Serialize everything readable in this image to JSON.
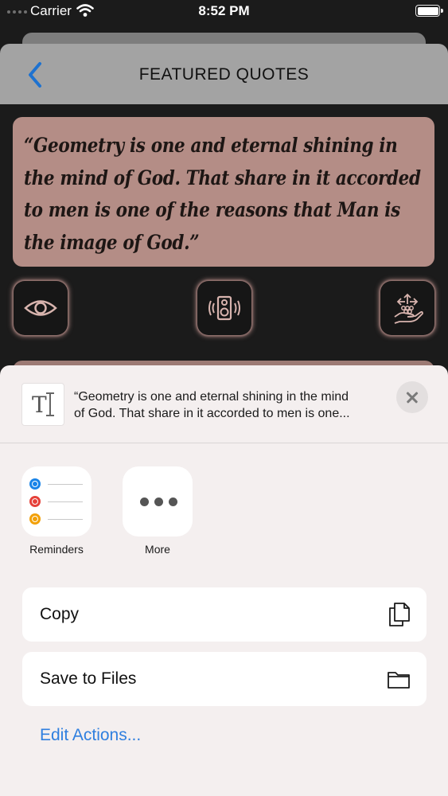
{
  "status_bar": {
    "carrier": "Carrier",
    "time": "8:52 PM"
  },
  "nav": {
    "title": "FEATURED QUOTES",
    "back_icon": "chevron-left-icon"
  },
  "quote": {
    "text": "“Geometry is one and eternal shining in the mind of God. That share in it accorded to men is one of the reasons that Man is the image of God.”"
  },
  "quote_actions": {
    "view_icon": "eye-icon",
    "speak_icon": "speaker-icon",
    "share_icon": "share-hand-icon"
  },
  "share_sheet": {
    "preview_line1": "“Geometry is one and eternal shining in the mind",
    "preview_line2": "of God. That share in it accorded to men is one...",
    "apps": [
      {
        "label": "Reminders",
        "icon": "reminders-icon"
      },
      {
        "label": "More",
        "icon": "more-icon"
      }
    ],
    "actions": [
      {
        "label": "Copy",
        "icon": "copy-icon"
      },
      {
        "label": "Save to Files",
        "icon": "folder-icon"
      }
    ],
    "edit_actions": "Edit Actions..."
  },
  "colors": {
    "accent": "#2f7fdf",
    "quote_card": "#b48d86",
    "reminder_dots": [
      "#1a84e8",
      "#e5413a",
      "#f2a007"
    ]
  }
}
